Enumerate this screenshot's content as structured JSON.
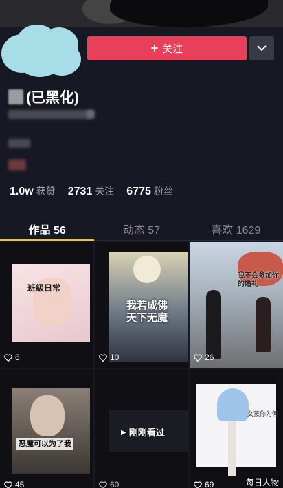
{
  "header": {
    "follow_label": "关注",
    "follow_icon": "plus-icon",
    "more_icon": "chevron-down-icon"
  },
  "profile": {
    "name_suffix": "(已黑化)"
  },
  "stats": [
    {
      "value": "1.0w",
      "label": "获赞"
    },
    {
      "value": "2731",
      "label": "关注"
    },
    {
      "value": "6775",
      "label": "粉丝"
    }
  ],
  "tabs": [
    {
      "label": "作品 56",
      "active": true
    },
    {
      "label": "动态 57",
      "active": false
    },
    {
      "label": "喜欢 1629",
      "active": false
    }
  ],
  "videos": [
    {
      "likes": "6",
      "caption": "班級日常"
    },
    {
      "likes": "10",
      "caption": "我若成佛\n天下无魔"
    },
    {
      "likes": "26",
      "caption": "我不会参加你的婚礼"
    },
    {
      "likes": "45",
      "caption": "恶魔可以为了我"
    },
    {
      "likes": "60",
      "caption": "刚刚看过"
    },
    {
      "likes": "69",
      "caption": "女孩你为何"
    }
  ],
  "watermark": "每日人物",
  "colors": {
    "accent": "#e8405b",
    "tab_underline": "#f1c232",
    "background": "#161823"
  }
}
